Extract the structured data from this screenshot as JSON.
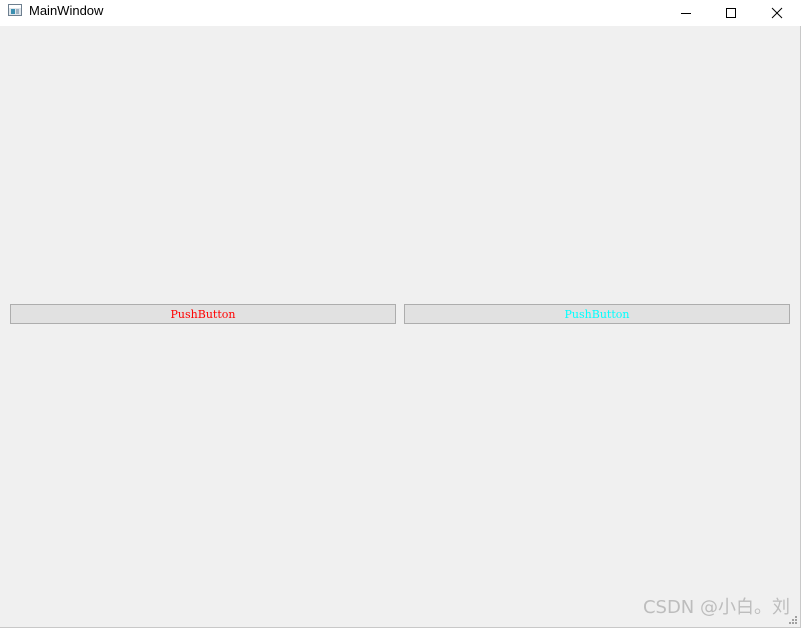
{
  "window": {
    "title": "MainWindow"
  },
  "icons": {
    "app": "app-window-icon",
    "minimize": "minimize-icon",
    "maximize": "maximize-icon",
    "close": "close-icon",
    "grip": "resize-grip-icon"
  },
  "buttons": {
    "left": {
      "label": "PushButton",
      "text_color": "#ff0000"
    },
    "right": {
      "label": "PushButton",
      "text_color": "#00ffff"
    }
  },
  "colors": {
    "window_bg": "#f0f0f0",
    "titlebar_bg": "#ffffff",
    "button_bg": "#e1e1e1",
    "button_border": "#adadad"
  },
  "watermark": {
    "text": "CSDN @小白。刘"
  }
}
